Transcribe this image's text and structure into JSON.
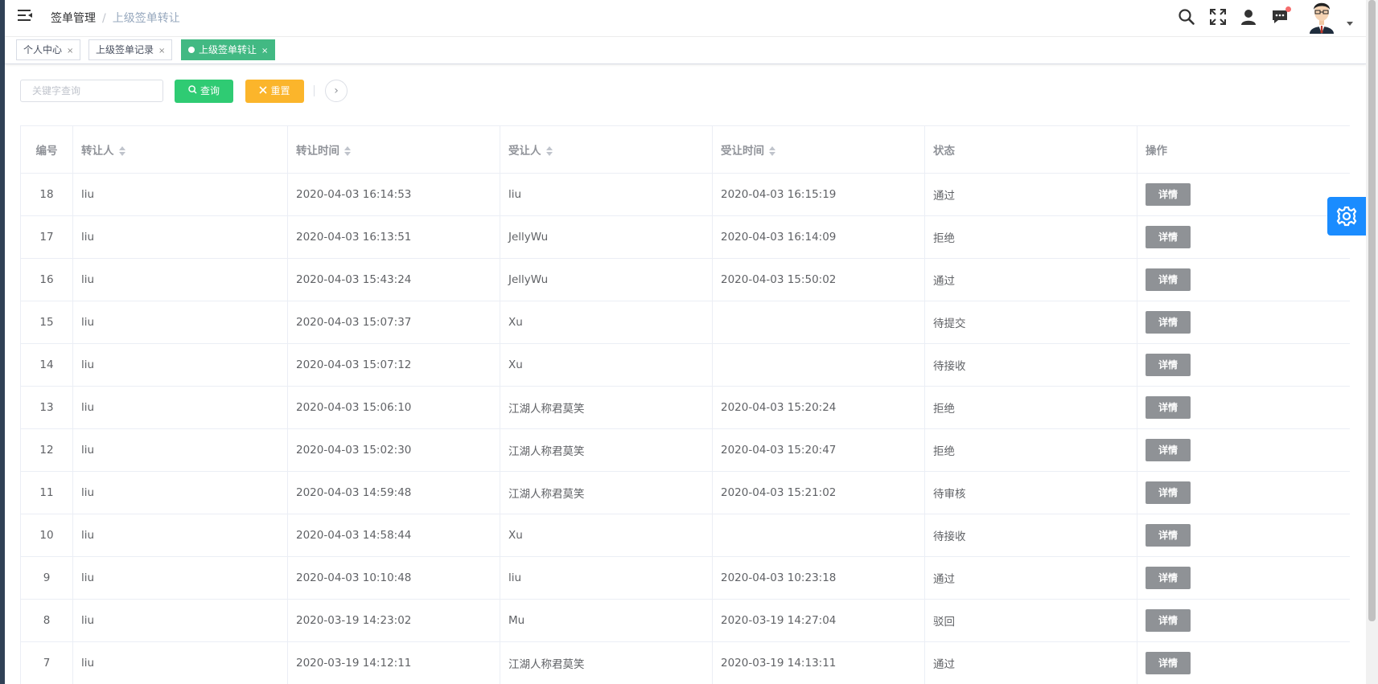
{
  "header": {
    "breadcrumb": [
      "签单管理",
      "上级签单转让"
    ],
    "separator": "/",
    "icons": [
      "menu-fold-icon",
      "search-icon",
      "fullscreen-icon",
      "user-icon",
      "message-icon",
      "avatar"
    ]
  },
  "tags": [
    {
      "label": "个人中心",
      "close": "×",
      "active": false
    },
    {
      "label": "上级签单记录",
      "close": "×",
      "active": false
    },
    {
      "label": "上级签单转让",
      "close": "×",
      "active": true
    }
  ],
  "toolbar": {
    "search_placeholder": "关键字查询",
    "search_value": "",
    "query_label": "查询",
    "reset_label": "重置",
    "expand_symbol": "›"
  },
  "table": {
    "columns": [
      "编号",
      "转让人",
      "转让时间",
      "受让人",
      "受让时间",
      "状态",
      "操作"
    ],
    "sortable": [
      false,
      true,
      true,
      true,
      true,
      false,
      false
    ],
    "action_label": "详情",
    "rows": [
      {
        "id": "18",
        "from": "liu",
        "from_time": "2020-04-03 16:14:53",
        "to": "liu",
        "to_time": "2020-04-03 16:15:19",
        "status": "通过"
      },
      {
        "id": "17",
        "from": "liu",
        "from_time": "2020-04-03 16:13:51",
        "to": "JellyWu",
        "to_time": "2020-04-03 16:14:09",
        "status": "拒绝"
      },
      {
        "id": "16",
        "from": "liu",
        "from_time": "2020-04-03 15:43:24",
        "to": "JellyWu",
        "to_time": "2020-04-03 15:50:02",
        "status": "通过"
      },
      {
        "id": "15",
        "from": "liu",
        "from_time": "2020-04-03 15:07:37",
        "to": "Xu",
        "to_time": "",
        "status": "待提交"
      },
      {
        "id": "14",
        "from": "liu",
        "from_time": "2020-04-03 15:07:12",
        "to": "Xu",
        "to_time": "",
        "status": "待接收"
      },
      {
        "id": "13",
        "from": "liu",
        "from_time": "2020-04-03 15:06:10",
        "to": "江湖人称君莫笑",
        "to_time": "2020-04-03 15:20:24",
        "status": "拒绝"
      },
      {
        "id": "12",
        "from": "liu",
        "from_time": "2020-04-03 15:02:30",
        "to": "江湖人称君莫笑",
        "to_time": "2020-04-03 15:20:47",
        "status": "拒绝"
      },
      {
        "id": "11",
        "from": "liu",
        "from_time": "2020-04-03 14:59:48",
        "to": "江湖人称君莫笑",
        "to_time": "2020-04-03 15:21:02",
        "status": "待审核"
      },
      {
        "id": "10",
        "from": "liu",
        "from_time": "2020-04-03 14:58:44",
        "to": "Xu",
        "to_time": "",
        "status": "待接收"
      },
      {
        "id": "9",
        "from": "liu",
        "from_time": "2020-04-03 10:10:48",
        "to": "liu",
        "to_time": "2020-04-03 10:23:18",
        "status": "通过"
      },
      {
        "id": "8",
        "from": "liu",
        "from_time": "2020-03-19 14:23:02",
        "to": "Mu",
        "to_time": "2020-03-19 14:27:04",
        "status": "驳回"
      },
      {
        "id": "7",
        "from": "liu",
        "from_time": "2020-03-19 14:12:11",
        "to": "江湖人称君莫笑",
        "to_time": "2020-03-19 14:13:11",
        "status": "通过"
      }
    ]
  },
  "colors": {
    "active_tag": "#42b983",
    "query_button": "#2fcb73",
    "reset_button": "#fbb52b",
    "detail_button": "#8f9296",
    "settings_button": "#1a8cff",
    "notify_dot": "#f56c6c"
  },
  "side": {
    "settings_icon": "gear-icon"
  }
}
